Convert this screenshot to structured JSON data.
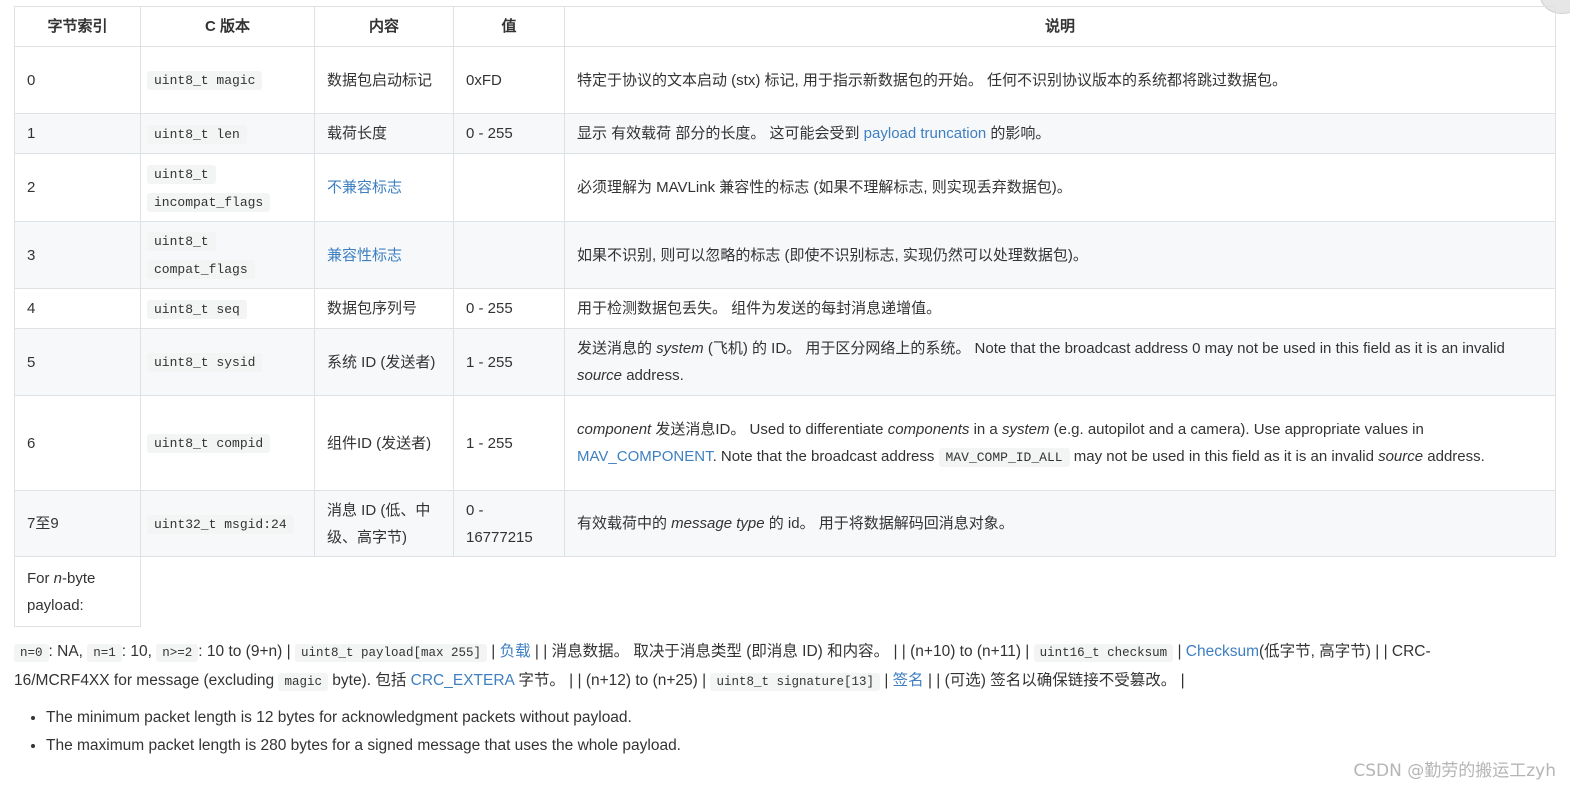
{
  "table": {
    "headers": [
      "字节索引",
      "C 版本",
      "内容",
      "值",
      "说明"
    ],
    "rows": [
      {
        "index": "0",
        "code": "uint8_t magic",
        "content": "数据包启动标记",
        "value": "0xFD",
        "desc": "特定于协议的文本启动 (stx) 标记, 用于指示新数据包的开始。 任何不识别协议版本的系统都将跳过数据包。"
      },
      {
        "index": "1",
        "code": "uint8_t len",
        "content": "载荷长度",
        "value": "0 - 255",
        "desc_a": "显示 有效载荷 部分的长度。 这可能会受到 ",
        "desc_link": "payload truncation",
        "desc_b": " 的影响。"
      },
      {
        "index": "2",
        "code_a": "uint8_t",
        "code_b": "incompat_flags",
        "content_link": "不兼容标志",
        "value": "",
        "desc": "必须理解为 MAVLink 兼容性的标志 (如果不理解标志, 则实现丢弃数据包)。"
      },
      {
        "index": "3",
        "code_a": "uint8_t",
        "code_b": "compat_flags",
        "content_link": "兼容性标志",
        "value": "",
        "desc": "如果不识别, 则可以忽略的标志 (即使不识别标志, 实现仍然可以处理数据包)。"
      },
      {
        "index": "4",
        "code": "uint8_t seq",
        "content": "数据包序列号",
        "value": "0 - 255",
        "desc": "用于检测数据包丢失。 组件为发送的每封消息递增值。"
      },
      {
        "index": "5",
        "code": "uint8_t sysid",
        "content": "系统 ID (发送者)",
        "value": "1 - 255",
        "desc_a": "发送消息的 ",
        "desc_em1": "system",
        "desc_b": " (飞机) 的 ID。 用于区分网络上的系统。 Note that the broadcast address 0 may not be used in this field as it is an invalid ",
        "desc_em2": "source",
        "desc_c": " address."
      },
      {
        "index": "6",
        "code": "uint8_t compid",
        "content": "组件ID (发送者)",
        "value": "1 - 255",
        "desc_em1": "component",
        "desc_a": " 发送消息ID。 Used to differentiate ",
        "desc_em2": "components",
        "desc_b": " in a ",
        "desc_em3": "system",
        "desc_c": " (e.g. autopilot and a camera). Use appropriate values in ",
        "desc_link": "MAV_COMPONENT",
        "desc_d": ". Note that the broadcast address ",
        "desc_code": "MAV_COMP_ID_ALL",
        "desc_e": " may not be used in this field as it is an invalid ",
        "desc_em4": "source",
        "desc_f": " address."
      },
      {
        "index": "7至9",
        "code": "uint32_t msgid:24",
        "content": "消息 ID (低、中级、高字节)",
        "value": "0 - 16777215",
        "desc_a": "有效载荷中的 ",
        "desc_em1": "message type",
        "desc_b": " 的 id。 用于将数据解码回消息对象。"
      }
    ],
    "trailing_a": "For ",
    "trailing_em": "n",
    "trailing_b": "-byte payload:"
  },
  "para": {
    "c1": "n=0",
    "t1": ": NA, ",
    "c2": "n=1",
    "t2": ": 10, ",
    "c3": "n>=2",
    "t3": ": 10 to (9+n) | ",
    "c4": "uint8_t payload[max 255]",
    "t4": " | ",
    "l1": "负载",
    "t5": " | | 消息数据。 取决于消息类型 (即消息 ID) 和内容。 | | (n+10) to (n+11) | ",
    "c5": "uint16_t checksum",
    "t6": " | ",
    "l2": "Checksum",
    "t7": "(低字节, 高字节) | | CRC-16/MCRF4XX for message (excluding ",
    "c6": "magic",
    "t8": " byte). 包括 ",
    "l3": "CRC_EXTERA",
    "t9": " 字节。 | | (n+12) to (n+25) | ",
    "c7": "uint8_t signature[13]",
    "t10": " | ",
    "l4": "签名",
    "t11": " | | (可选) 签名以确保链接不受篡改。 |"
  },
  "notes": [
    "The minimum packet length is 12 bytes for acknowledgment packets without payload.",
    "The maximum packet length is 280 bytes for a signed message that uses the whole payload."
  ],
  "watermark": "CSDN @勤劳的搬运工zyh",
  "colors": {
    "link": "#3e7fc1",
    "border": "#dfe2e5",
    "stripe": "#f6f8fa",
    "code_bg": "#f3f4f4"
  }
}
